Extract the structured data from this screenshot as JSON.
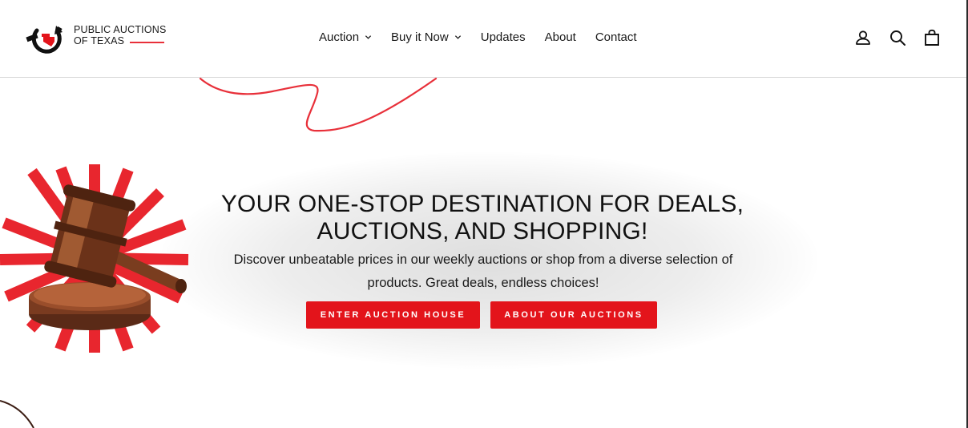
{
  "brand": {
    "line1": "PUBLIC AUCTIONS",
    "line2": "OF TEXAS",
    "accent_color": "#e8303a"
  },
  "nav": {
    "items": [
      {
        "label": "Auction",
        "has_dropdown": true
      },
      {
        "label": "Buy it Now",
        "has_dropdown": true
      },
      {
        "label": "Updates",
        "has_dropdown": false
      },
      {
        "label": "About",
        "has_dropdown": false
      },
      {
        "label": "Contact",
        "has_dropdown": false
      }
    ]
  },
  "header_icons": [
    "account-icon",
    "search-icon",
    "cart-icon"
  ],
  "hero": {
    "title": "YOUR ONE-STOP DESTINATION FOR DEALS, AUCTIONS, AND SHOPPING!",
    "subtitle": "Discover unbeatable prices in our weekly auctions or shop from a diverse selection of products. Great deals, endless choices!",
    "buttons": {
      "enter": "ENTER AUCTION HOUSE",
      "about": "ABOUT OUR AUCTIONS"
    },
    "button_color": "#e3141b"
  }
}
